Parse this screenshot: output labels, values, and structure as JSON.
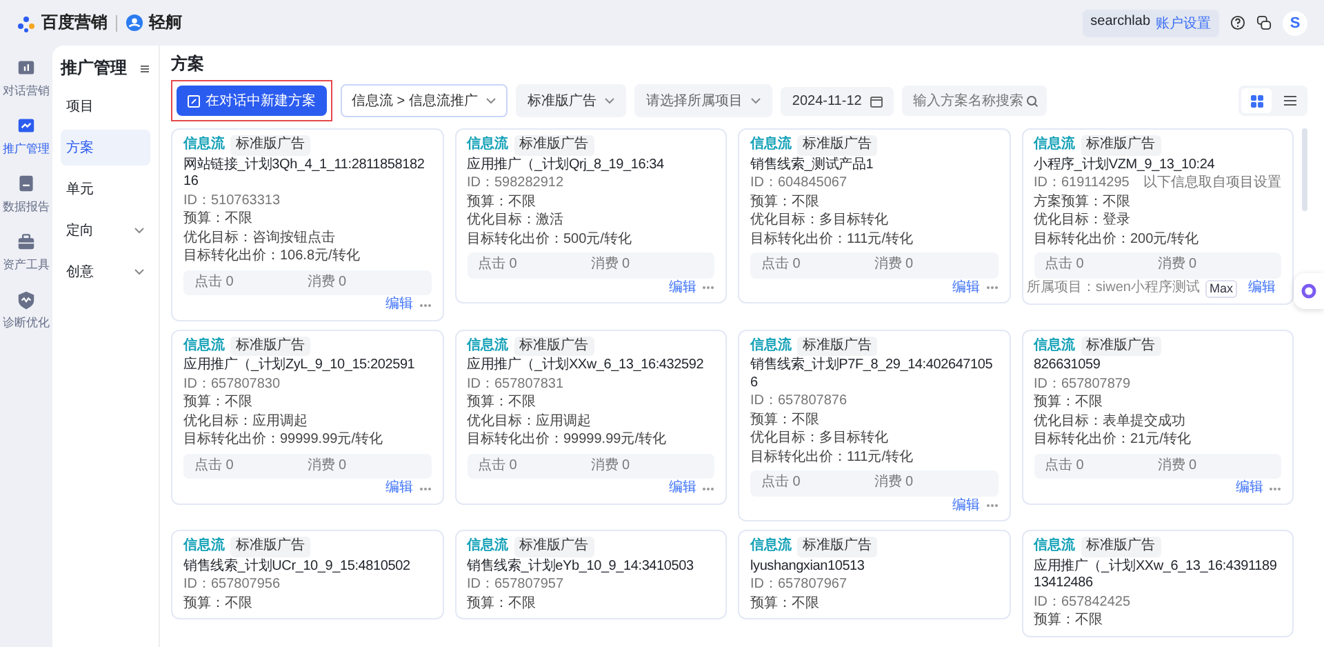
{
  "header": {
    "brand": "百度营销",
    "product": "轻舸",
    "account": "searchlab",
    "account_link": "账户设置",
    "avatar": "S"
  },
  "rail": [
    {
      "label": "对话营销",
      "selected": false
    },
    {
      "label": "推广管理",
      "selected": true
    },
    {
      "label": "数据报告",
      "selected": false
    },
    {
      "label": "资产工具",
      "selected": false
    },
    {
      "label": "诊断优化",
      "selected": false
    }
  ],
  "sidebar": {
    "title": "推广管理",
    "items": [
      {
        "label": "项目",
        "selected": false,
        "expandable": false
      },
      {
        "label": "方案",
        "selected": true,
        "expandable": false
      },
      {
        "label": "单元",
        "selected": false,
        "expandable": false
      },
      {
        "label": "定向",
        "selected": false,
        "expandable": true
      },
      {
        "label": "创意",
        "selected": false,
        "expandable": true
      }
    ]
  },
  "page_title": "方案",
  "toolbar": {
    "new_button": {
      "label": "在对话中新建方案",
      "highlighted": true
    },
    "channel_select": "信息流 > 信息流推广",
    "type_select": "标准版广告",
    "project_select": {
      "placeholder": "请选择所属项目"
    },
    "date": "2024-11-12",
    "search": {
      "placeholder": "输入方案名称搜索"
    },
    "views": [
      {
        "kind": "grid",
        "selected": true
      },
      {
        "kind": "list",
        "selected": false
      }
    ]
  },
  "cards": [
    {
      "channel": "信息流",
      "type": "标准版广告",
      "title": "网站链接_计划3Qh_4_1_11:281185818216",
      "id": "ID：510763313",
      "fields": [
        "预算：不限",
        "优化目标：咨询按钮点击",
        "目标转化出价：106.8元/转化"
      ],
      "stats": [
        {
          "label": "点击",
          "value": "0"
        },
        {
          "label": "消费",
          "value": "0"
        }
      ],
      "edit": "编辑"
    },
    {
      "channel": "信息流",
      "type": "标准版广告",
      "title": "应用推广（_计划Qrj_8_19_16:34",
      "id": "ID：598282912",
      "fields": [
        "预算：不限",
        "优化目标：激活",
        "目标转化出价：500元/转化"
      ],
      "stats": [
        {
          "label": "点击",
          "value": "0"
        },
        {
          "label": "消费",
          "value": "0"
        }
      ],
      "edit": "编辑"
    },
    {
      "channel": "信息流",
      "type": "标准版广告",
      "title": "销售线索_测试产品1",
      "id": "ID：604845067",
      "fields": [
        "预算：不限",
        "优化目标：多目标转化",
        "目标转化出价：111元/转化"
      ],
      "stats": [
        {
          "label": "点击",
          "value": "0"
        },
        {
          "label": "消费",
          "value": "0"
        }
      ],
      "edit": "编辑"
    },
    {
      "channel": "信息流",
      "type": "标准版广告",
      "title": "小程序_计划VZM_9_13_10:24",
      "id": "ID：619114295",
      "note": "以下信息取自项目设置",
      "fields": [
        "方案预算：不限",
        "优化目标：登录",
        "目标转化出价：200元/转化"
      ],
      "stats": [
        {
          "label": "点击",
          "value": "0"
        },
        {
          "label": "消费",
          "value": "0"
        }
      ],
      "project": "所属项目：siwen小程序测试",
      "project_badge": "Max",
      "edit": "编辑"
    },
    {
      "channel": "信息流",
      "type": "标准版广告",
      "title": "应用推广（_计划ZyL_9_10_15:202591",
      "id": "ID：657807830",
      "fields": [
        "预算：不限",
        "优化目标：应用调起",
        "目标转化出价：99999.99元/转化"
      ],
      "stats": [
        {
          "label": "点击",
          "value": "0"
        },
        {
          "label": "消费",
          "value": "0"
        }
      ],
      "edit": "编辑"
    },
    {
      "channel": "信息流",
      "type": "标准版广告",
      "title": "应用推广（_计划XXw_6_13_16:432592",
      "id": "ID：657807831",
      "fields": [
        "预算：不限",
        "优化目标：应用调起",
        "目标转化出价：99999.99元/转化"
      ],
      "stats": [
        {
          "label": "点击",
          "value": "0"
        },
        {
          "label": "消费",
          "value": "0"
        }
      ],
      "edit": "编辑"
    },
    {
      "channel": "信息流",
      "type": "标准版广告",
      "title": "销售线索_计划P7F_8_29_14:4026471056",
      "id": "ID：657807876",
      "fields": [
        "预算：不限",
        "优化目标：多目标转化",
        "目标转化出价：111元/转化"
      ],
      "stats": [
        {
          "label": "点击",
          "value": "0"
        },
        {
          "label": "消费",
          "value": "0"
        }
      ],
      "edit": "编辑"
    },
    {
      "channel": "信息流",
      "type": "标准版广告",
      "title": "826631059",
      "id": "ID：657807879",
      "fields": [
        "预算：不限",
        "优化目标：表单提交成功",
        "目标转化出价：21元/转化"
      ],
      "stats": [
        {
          "label": "点击",
          "value": "0"
        },
        {
          "label": "消费",
          "value": "0"
        }
      ],
      "edit": "编辑"
    },
    {
      "channel": "信息流",
      "type": "标准版广告",
      "title": "销售线索_计划UCr_10_9_15:4810502",
      "id": "ID：657807956",
      "fields": [
        "预算：不限"
      ]
    },
    {
      "channel": "信息流",
      "type": "标准版广告",
      "title": "销售线索_计划eYb_10_9_14:3410503",
      "id": "ID：657807957",
      "fields": [
        "预算：不限"
      ]
    },
    {
      "channel": "信息流",
      "type": "标准版广告",
      "title": "lyushangxian10513",
      "id": "ID：657807967",
      "fields": [
        "预算：不限"
      ]
    },
    {
      "channel": "信息流",
      "type": "标准版广告",
      "title": "应用推广（_计划XXw_6_13_16:439118913412486",
      "id": "ID：657842425",
      "fields": [
        "预算：不限"
      ]
    }
  ]
}
